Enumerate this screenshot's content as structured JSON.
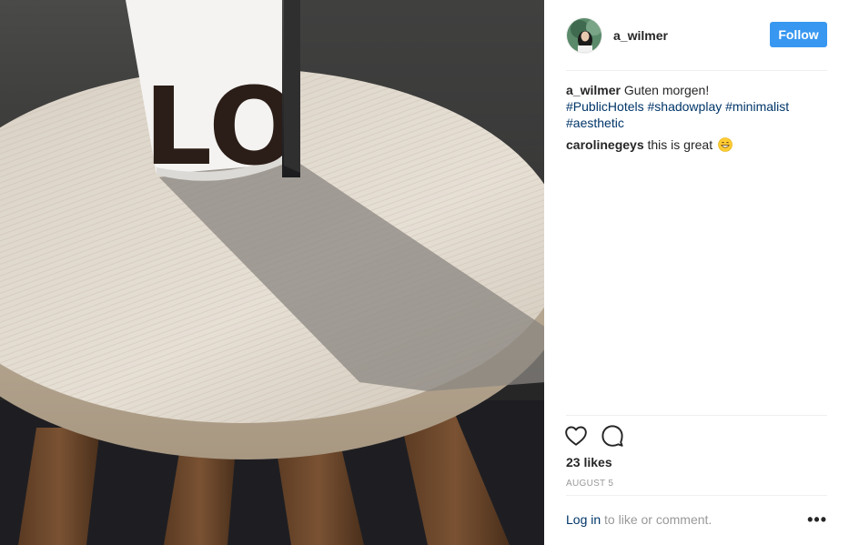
{
  "post": {
    "username": "a_wilmer",
    "follow_label": "Follow",
    "caption_user": "a_wilmer",
    "caption_text": "Guten morgen!",
    "hashtags": [
      "#PublicHotels",
      "#shadowplay",
      "#minimalist",
      "#aesthetic"
    ],
    "comments": [
      {
        "user": "carolinegeys",
        "text": "this is great",
        "emoji": "grinning-face-emoji"
      }
    ],
    "likes": "23 likes",
    "date": "AUGUST 5",
    "login_link": "Log in",
    "login_suffix": " to like or comment.",
    "more_label": "•••",
    "photo_cup_letters": "LO"
  },
  "icons": {
    "like": "heart-outline-icon",
    "comment": "speech-bubble-icon",
    "more": "ellipsis-icon"
  },
  "colors": {
    "follow_button": "#3897f0",
    "hashtag": "#003569",
    "muted_text": "#999999",
    "divider": "#efefef"
  }
}
